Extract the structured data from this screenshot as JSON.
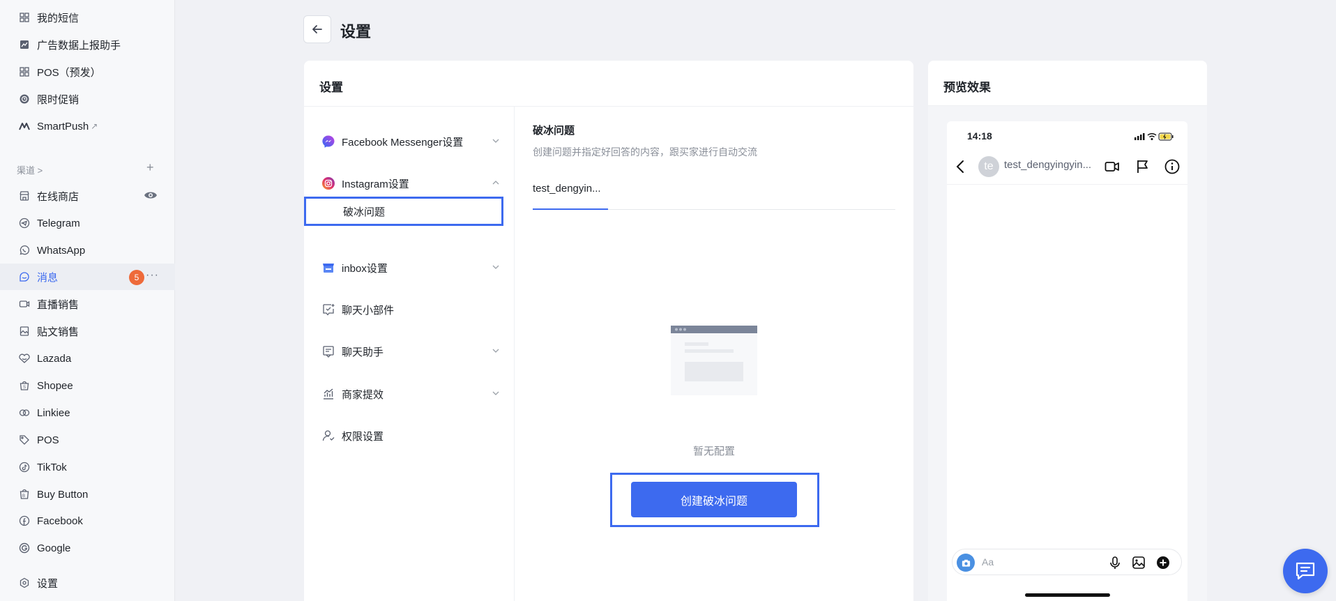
{
  "sidebar": {
    "top_items": [
      {
        "label": "我的短信",
        "icon": "grid-icon"
      },
      {
        "label": "广告数据上报助手",
        "icon": "chart-box-icon"
      },
      {
        "label": "POS（预发）",
        "icon": "grid-icon"
      },
      {
        "label": "限时促销",
        "icon": "clock-badge-icon"
      },
      {
        "label": "SmartPush",
        "icon": "smartpush-logo-icon"
      }
    ],
    "section_label": "渠道 >",
    "section_add": "+",
    "channels": [
      {
        "label": "在线商店",
        "icon": "store-icon"
      },
      {
        "label": "Telegram",
        "icon": "telegram-icon"
      },
      {
        "label": "WhatsApp",
        "icon": "whatsapp-icon"
      },
      {
        "label": "消息",
        "icon": "message-icon",
        "badge": "5",
        "active": true
      },
      {
        "label": "直播销售",
        "icon": "live-icon"
      },
      {
        "label": "贴文销售",
        "icon": "post-icon"
      },
      {
        "label": "Lazada",
        "icon": "lazada-icon"
      },
      {
        "label": "Shopee",
        "icon": "shopee-icon"
      },
      {
        "label": "Linkiee",
        "icon": "link-icon"
      },
      {
        "label": "POS",
        "icon": "tag-icon"
      },
      {
        "label": "TikTok",
        "icon": "tiktok-icon"
      },
      {
        "label": "Buy Button",
        "icon": "buy-button-icon"
      },
      {
        "label": "Facebook",
        "icon": "facebook-icon"
      },
      {
        "label": "Google",
        "icon": "google-icon"
      }
    ],
    "settings_label": "设置",
    "more": "···"
  },
  "header": {
    "title": "设置"
  },
  "settings_card": {
    "title": "设置",
    "menu": [
      {
        "label": "Facebook Messenger设置",
        "icon": "messenger-icon",
        "expandable": true
      },
      {
        "label": "Instagram设置",
        "icon": "instagram-icon",
        "expandable": true,
        "expanded": true
      },
      {
        "label": "破冰问题",
        "sub": true,
        "selected": true
      },
      {
        "label": "inbox设置",
        "icon": "inbox-icon",
        "expandable": true
      },
      {
        "label": "聊天小部件",
        "icon": "chat-widget-icon",
        "expandable": false
      },
      {
        "label": "聊天助手",
        "icon": "chat-assistant-icon",
        "expandable": true
      },
      {
        "label": "商家提效",
        "icon": "analytics-icon",
        "expandable": true
      },
      {
        "label": "权限设置",
        "icon": "user-permission-icon",
        "expandable": false
      }
    ],
    "content": {
      "title": "破冰问题",
      "description": "创建问题并指定好回答的内容，跟买家进行自动交流",
      "tab": "test_dengyin...",
      "empty_text": "暂无配置",
      "create_button": "创建破冰问题"
    }
  },
  "preview": {
    "title": "预览效果",
    "phone": {
      "time": "14:18",
      "avatar_text": "te",
      "chat_name": "test_dengyingyin...",
      "composer_placeholder": "Aa"
    }
  },
  "colors": {
    "accent": "#3d6aef",
    "badge": "#ee6a3a"
  }
}
